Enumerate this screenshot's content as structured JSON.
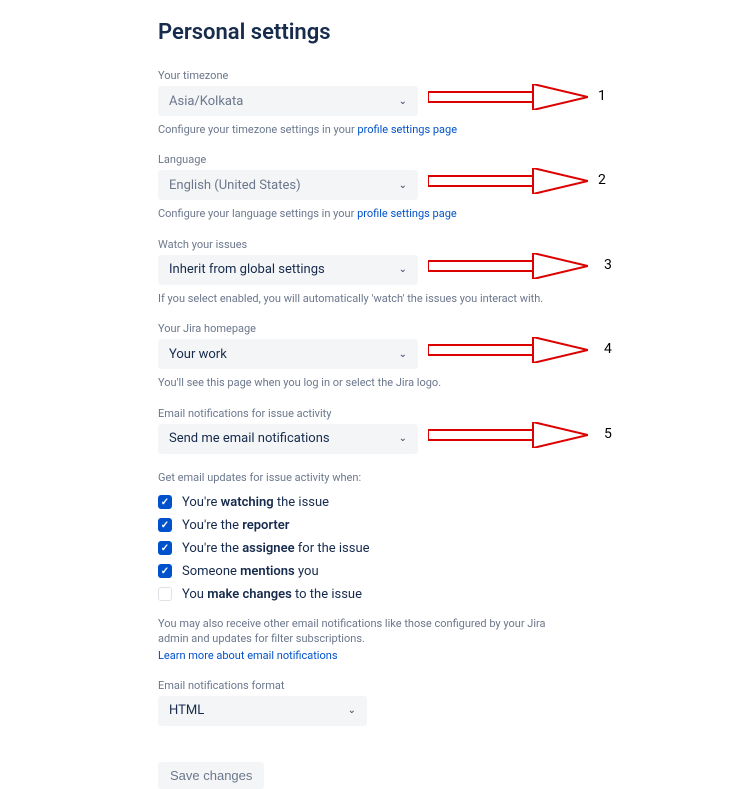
{
  "title": "Personal settings",
  "fields": {
    "timezone": {
      "label": "Your timezone",
      "value": "Asia/Kolkata",
      "help_prefix": "Configure your timezone settings in your ",
      "help_link": "profile settings page"
    },
    "language": {
      "label": "Language",
      "value": "English (United States)",
      "help_prefix": "Configure your language settings in your ",
      "help_link": "profile settings page"
    },
    "watch": {
      "label": "Watch your issues",
      "value": "Inherit from global settings",
      "help": "If you select enabled, you will automatically 'watch' the issues you interact with."
    },
    "homepage": {
      "label": "Your Jira homepage",
      "value": "Your work",
      "help": "You'll see this page when you log in or select the Jira logo."
    },
    "email_notif": {
      "label": "Email notifications for issue activity",
      "value": "Send me email notifications"
    },
    "email_updates_intro": "Get email updates for issue activity when:",
    "checkboxes": [
      {
        "checked": true,
        "pre": "You're ",
        "bold": "watching",
        "post": " the issue"
      },
      {
        "checked": true,
        "pre": "You're the ",
        "bold": "reporter",
        "post": ""
      },
      {
        "checked": true,
        "pre": "You're the ",
        "bold": "assignee",
        "post": " for the issue"
      },
      {
        "checked": true,
        "pre": "Someone ",
        "bold": "mentions",
        "post": " you"
      },
      {
        "checked": false,
        "pre": "You ",
        "bold": "make changes",
        "post": " to the issue"
      }
    ],
    "email_footer": "You may also receive other email notifications like those configured by your Jira admin and updates for filter subscriptions.",
    "email_footer_link": "Learn more about email notifications",
    "format": {
      "label": "Email notifications format",
      "value": "HTML"
    }
  },
  "save_label": "Save changes",
  "annotations": [
    "1",
    "2",
    "3",
    "4",
    "5"
  ]
}
